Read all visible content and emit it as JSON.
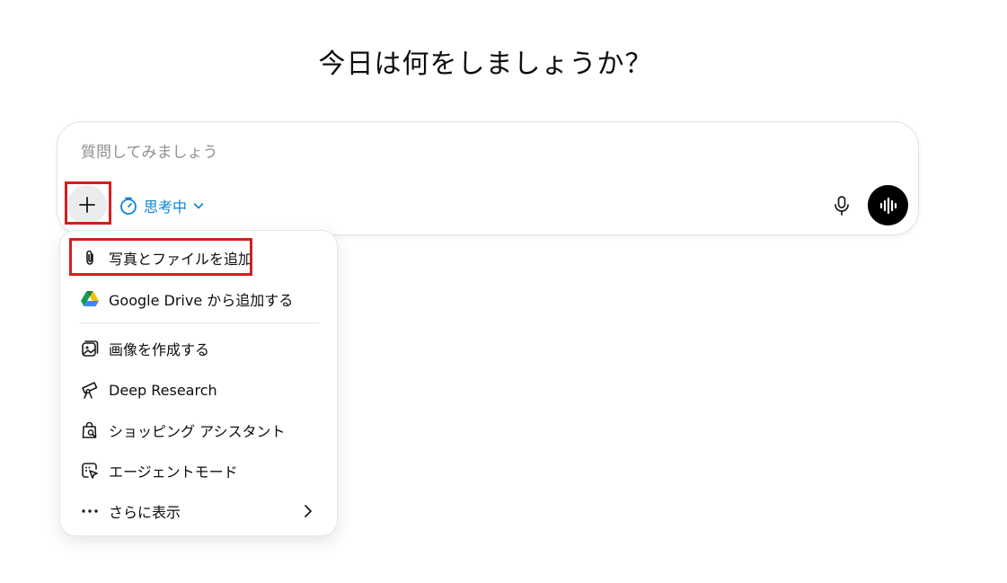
{
  "headline": "今日は何をしましょうか？",
  "composer": {
    "placeholder": "質問してみましょう",
    "value": "",
    "thinking_label": "思考中",
    "plus_icon": "plus-icon",
    "timer_icon": "stopwatch-icon",
    "mic_icon": "microphone-icon",
    "voice_icon": "voice-waveform-icon"
  },
  "menu": {
    "items": [
      {
        "label": "写真とファイルを追加",
        "icon": "paperclip-icon"
      },
      {
        "label": "Google Drive から追加する",
        "icon": "google-drive-icon"
      },
      {
        "label": "画像を作成する",
        "icon": "image-create-icon"
      },
      {
        "label": "Deep Research",
        "icon": "telescope-icon"
      },
      {
        "label": "ショッピング アシスタント",
        "icon": "shopping-bag-icon"
      },
      {
        "label": "エージェントモード",
        "icon": "agent-cursor-icon"
      },
      {
        "label": "さらに表示",
        "icon": "more-dots-icon"
      }
    ]
  },
  "colors": {
    "accent": "#0a84d6",
    "highlight": "#d21f1f"
  }
}
